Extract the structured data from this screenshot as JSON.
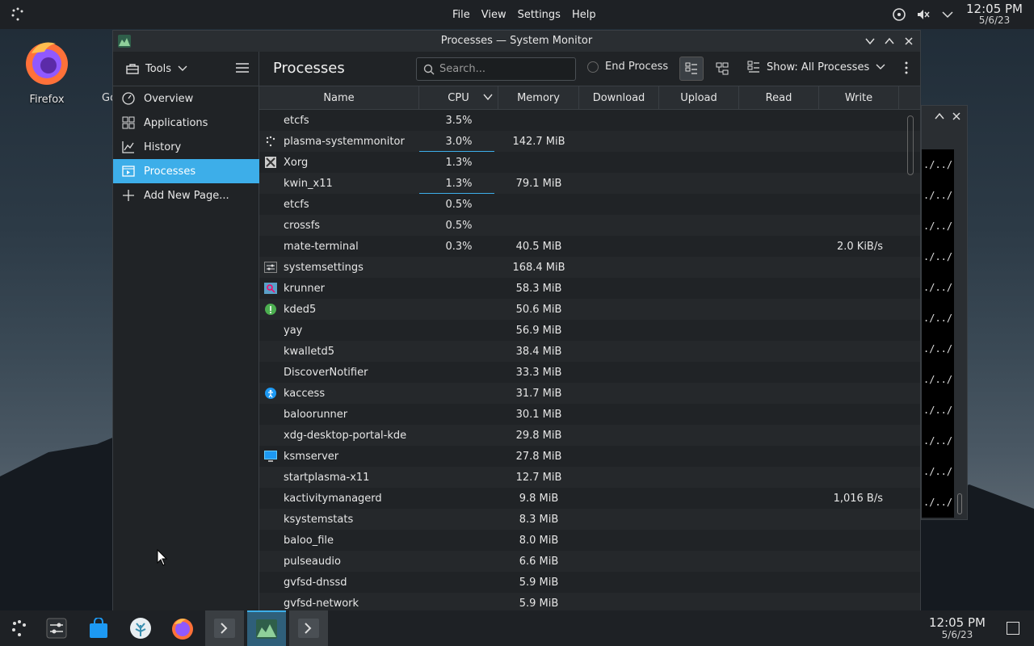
{
  "desktop": {
    "top_menu": [
      "File",
      "View",
      "Settings",
      "Help"
    ],
    "clock_time": "12:05 PM",
    "clock_date": "5/6/23",
    "icons": [
      {
        "label": "Firefox"
      },
      {
        "label": "Go"
      }
    ],
    "bg_terminal_lines": [
      "./../",
      "./../",
      "./../",
      "./../",
      "./../",
      "./../",
      "./../",
      "./../",
      "./../",
      "./../",
      "./../",
      "./../"
    ]
  },
  "window": {
    "title": "Processes — System Monitor",
    "tools_label": "Tools",
    "page_title": "Processes",
    "search_placeholder": "Search...",
    "end_process_label": "End Process",
    "show_label": "Show: All Processes"
  },
  "sidebar": {
    "items": [
      {
        "label": "Overview",
        "icon": "gauge-icon"
      },
      {
        "label": "Applications",
        "icon": "grid-icon"
      },
      {
        "label": "History",
        "icon": "chart-icon"
      },
      {
        "label": "Processes",
        "icon": "process-icon",
        "active": true
      },
      {
        "label": "Add New Page...",
        "icon": "plus-icon"
      }
    ]
  },
  "table": {
    "columns": [
      "Name",
      "CPU",
      "Memory",
      "Download",
      "Upload",
      "Read",
      "Write"
    ],
    "rows": [
      {
        "name": "etcfs",
        "cpu": "3.5%",
        "mem": "",
        "write": "",
        "icon": "",
        "cpu_frac": 0
      },
      {
        "name": "plasma-systemmonitor",
        "cpu": "3.0%",
        "mem": "142.7 MiB",
        "write": "",
        "icon": "plasma",
        "cpu_frac": 0.95
      },
      {
        "name": "Xorg",
        "cpu": "1.3%",
        "mem": "",
        "write": "",
        "icon": "xorg",
        "cpu_frac": 0
      },
      {
        "name": "kwin_x11",
        "cpu": "1.3%",
        "mem": "79.1 MiB",
        "write": "",
        "icon": "",
        "cpu_frac": 0.95
      },
      {
        "name": "etcfs",
        "cpu": "0.5%",
        "mem": "",
        "write": "",
        "icon": "",
        "cpu_frac": 0
      },
      {
        "name": "crossfs",
        "cpu": "0.5%",
        "mem": "",
        "write": "",
        "icon": "",
        "cpu_frac": 0
      },
      {
        "name": "mate-terminal",
        "cpu": "0.3%",
        "mem": "40.5 MiB",
        "write": "2.0 KiB/s",
        "icon": "",
        "cpu_frac": 0
      },
      {
        "name": "systemsettings",
        "cpu": "",
        "mem": "168.4 MiB",
        "write": "",
        "icon": "settings",
        "cpu_frac": 0
      },
      {
        "name": "krunner",
        "cpu": "",
        "mem": "58.3 MiB",
        "write": "",
        "icon": "krunner",
        "cpu_frac": 0
      },
      {
        "name": "kded5",
        "cpu": "",
        "mem": "50.6 MiB",
        "write": "",
        "icon": "kded",
        "cpu_frac": 0
      },
      {
        "name": "yay",
        "cpu": "",
        "mem": "56.9 MiB",
        "write": "",
        "icon": "",
        "cpu_frac": 0
      },
      {
        "name": "kwalletd5",
        "cpu": "",
        "mem": "38.4 MiB",
        "write": "",
        "icon": "",
        "cpu_frac": 0
      },
      {
        "name": "DiscoverNotifier",
        "cpu": "",
        "mem": "33.3 MiB",
        "write": "",
        "icon": "",
        "cpu_frac": 0
      },
      {
        "name": "kaccess",
        "cpu": "",
        "mem": "31.7 MiB",
        "write": "",
        "icon": "kaccess",
        "cpu_frac": 0
      },
      {
        "name": "baloorunner",
        "cpu": "",
        "mem": "30.1 MiB",
        "write": "",
        "icon": "",
        "cpu_frac": 0
      },
      {
        "name": "xdg-desktop-portal-kde",
        "cpu": "",
        "mem": "29.8 MiB",
        "write": "",
        "icon": "",
        "cpu_frac": 0
      },
      {
        "name": "ksmserver",
        "cpu": "",
        "mem": "27.8 MiB",
        "write": "",
        "icon": "ksm",
        "cpu_frac": 0
      },
      {
        "name": "startplasma-x11",
        "cpu": "",
        "mem": "12.7 MiB",
        "write": "",
        "icon": "",
        "cpu_frac": 0
      },
      {
        "name": "kactivitymanagerd",
        "cpu": "",
        "mem": "9.8 MiB",
        "write": "1,016 B/s",
        "icon": "",
        "cpu_frac": 0
      },
      {
        "name": "ksystemstats",
        "cpu": "",
        "mem": "8.3 MiB",
        "write": "",
        "icon": "",
        "cpu_frac": 0
      },
      {
        "name": "baloo_file",
        "cpu": "",
        "mem": "8.0 MiB",
        "write": "",
        "icon": "",
        "cpu_frac": 0
      },
      {
        "name": "pulseaudio",
        "cpu": "",
        "mem": "6.6 MiB",
        "write": "",
        "icon": "",
        "cpu_frac": 0
      },
      {
        "name": "gvfsd-dnssd",
        "cpu": "",
        "mem": "5.9 MiB",
        "write": "",
        "icon": "",
        "cpu_frac": 0
      },
      {
        "name": "gvfsd-network",
        "cpu": "",
        "mem": "5.9 MiB",
        "write": "",
        "icon": "",
        "cpu_frac": 0
      }
    ]
  },
  "colors": {
    "accent": "#3daee9",
    "panel": "#1e2125",
    "window_bg": "#202326"
  }
}
